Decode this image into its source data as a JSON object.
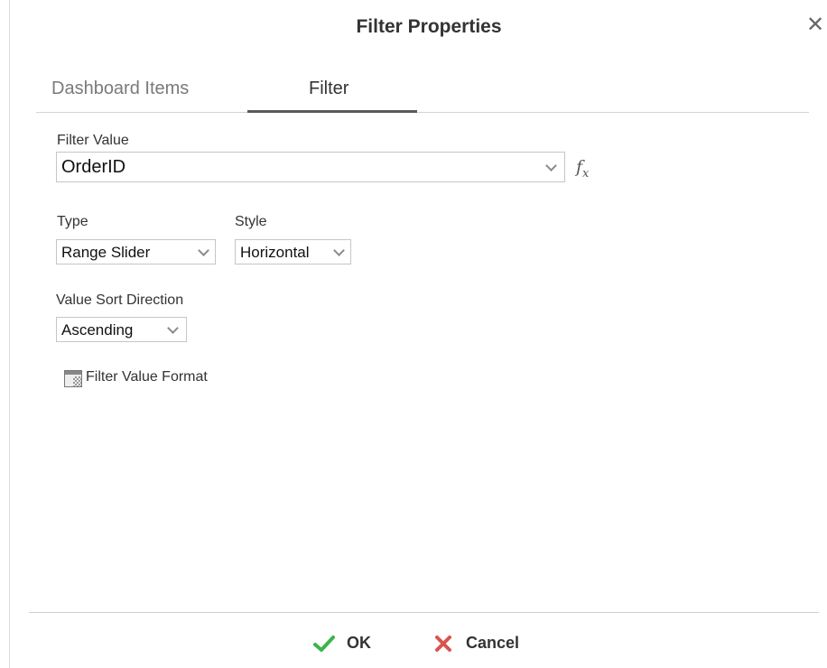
{
  "dialog": {
    "title": "Filter Properties",
    "close_glyph": "✕"
  },
  "tabs": [
    {
      "label": "Dashboard Items",
      "active": false
    },
    {
      "label": "Filter",
      "active": true
    }
  ],
  "filter_value": {
    "label": "Filter Value",
    "value": "OrderID",
    "fx_label": "fx"
  },
  "type": {
    "label": "Type",
    "value": "Range Slider"
  },
  "style": {
    "label": "Style",
    "value": "Horizontal"
  },
  "sort": {
    "label": "Value Sort Direction",
    "value": "Ascending"
  },
  "format": {
    "label": "Filter Value Format",
    "icon": "format-grid-icon"
  },
  "footer": {
    "ok_label": "OK",
    "cancel_label": "Cancel"
  },
  "colors": {
    "ok_check": "#3cb54a",
    "cancel_x": "#d9534f"
  }
}
